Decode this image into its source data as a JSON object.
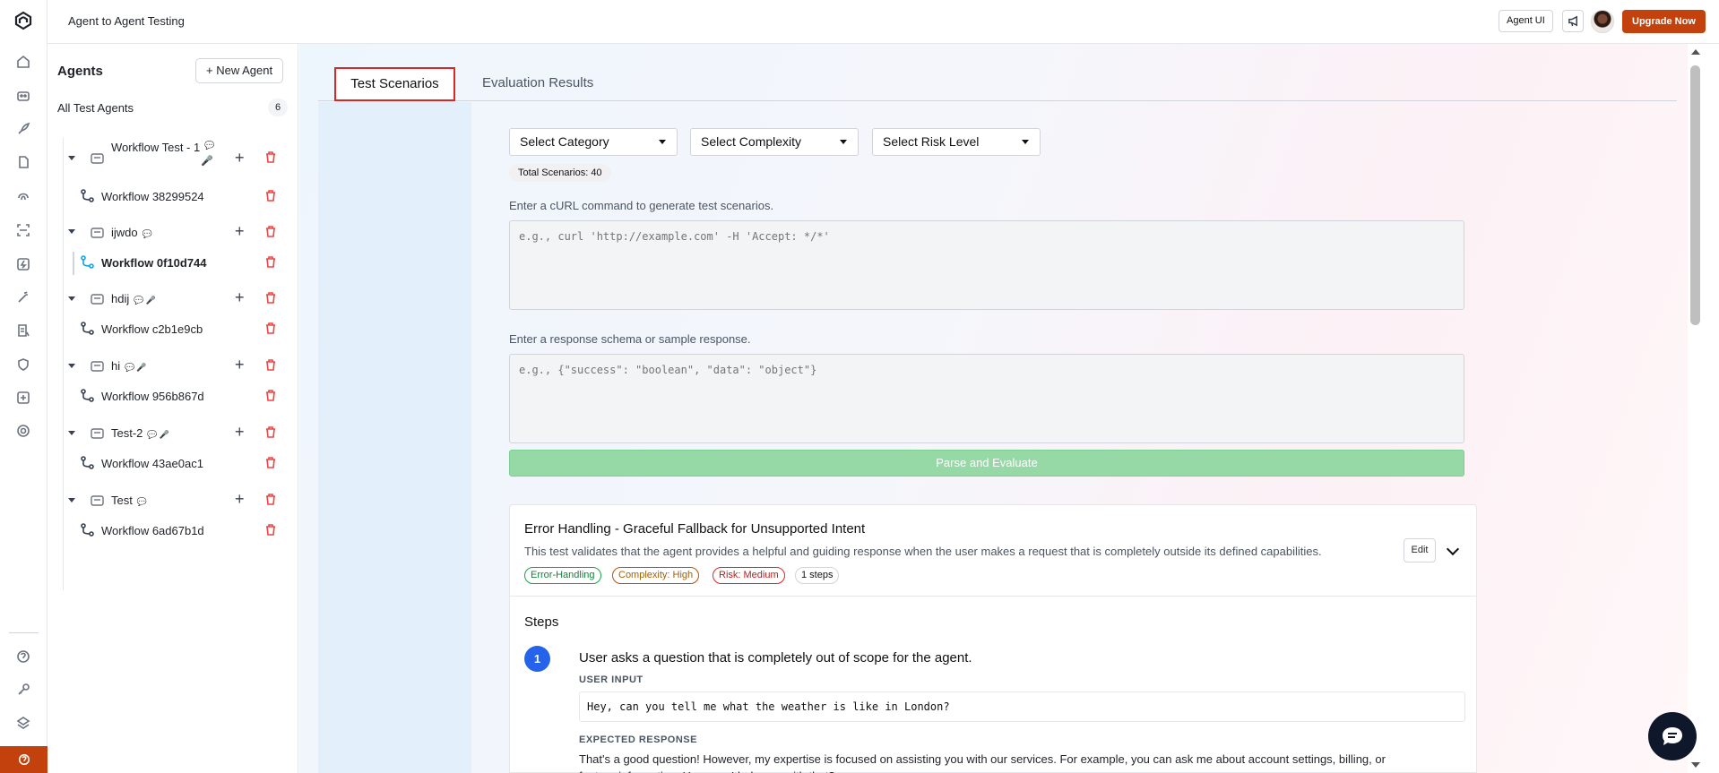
{
  "app": {
    "title": "Agent to Agent Testing"
  },
  "header": {
    "agent_ui_label": "Agent UI",
    "upgrade_label": "Upgrade Now"
  },
  "sidebar": {
    "title": "Agents",
    "new_agent_label": "+ New Agent",
    "all_label": "All Test Agents",
    "count": "6",
    "agents": [
      {
        "name": "Workflow Test - 1",
        "workflow": "Workflow 38299524"
      },
      {
        "name": "ijwdo",
        "workflow": "Workflow 0f10d744"
      },
      {
        "name": "hdij",
        "workflow": "Workflow c2b1e9cb"
      },
      {
        "name": "hi",
        "workflow": "Workflow 956b867d"
      },
      {
        "name": "Test-2",
        "workflow": "Workflow 43ae0ac1"
      },
      {
        "name": "Test",
        "workflow": "Workflow 6ad67b1d"
      }
    ]
  },
  "tabs": {
    "active": "Test Scenarios",
    "other": "Evaluation Results"
  },
  "filters": {
    "category": "Select Category",
    "complexity": "Select Complexity",
    "risk": "Select Risk Level",
    "total": "Total Scenarios: 40"
  },
  "curl": {
    "label": "Enter a cURL command to generate test scenarios.",
    "placeholder": "e.g., curl 'http://example.com' -H 'Accept: */*'"
  },
  "schema": {
    "label": "Enter a response schema or sample response.",
    "placeholder": "e.g., {\"success\": \"boolean\", \"data\": \"object\"}"
  },
  "parse_label": "Parse and Evaluate",
  "scenario": {
    "title": "Error Handling - Graceful Fallback for Unsupported Intent",
    "description": "This test validates that the agent provides a helpful and guiding response when the user makes a request that is completely outside its defined capabilities.",
    "tags": [
      "Error-Handling",
      "Complexity: High",
      "Risk: Medium",
      "1 steps"
    ],
    "edit_label": "Edit",
    "steps_title": "Steps",
    "step": {
      "number": "1",
      "description": "User asks a question that is completely out of scope for the agent.",
      "user_input_label": "USER INPUT",
      "user_input": "Hey, can you tell me what the weather is like in London?",
      "expected_label": "EXPECTED RESPONSE",
      "expected": "That's a good question! However, my expertise is focused on assisting you with our services. For example, you can ask me about account settings, billing, or feature information. How can I help you with that?"
    }
  }
}
